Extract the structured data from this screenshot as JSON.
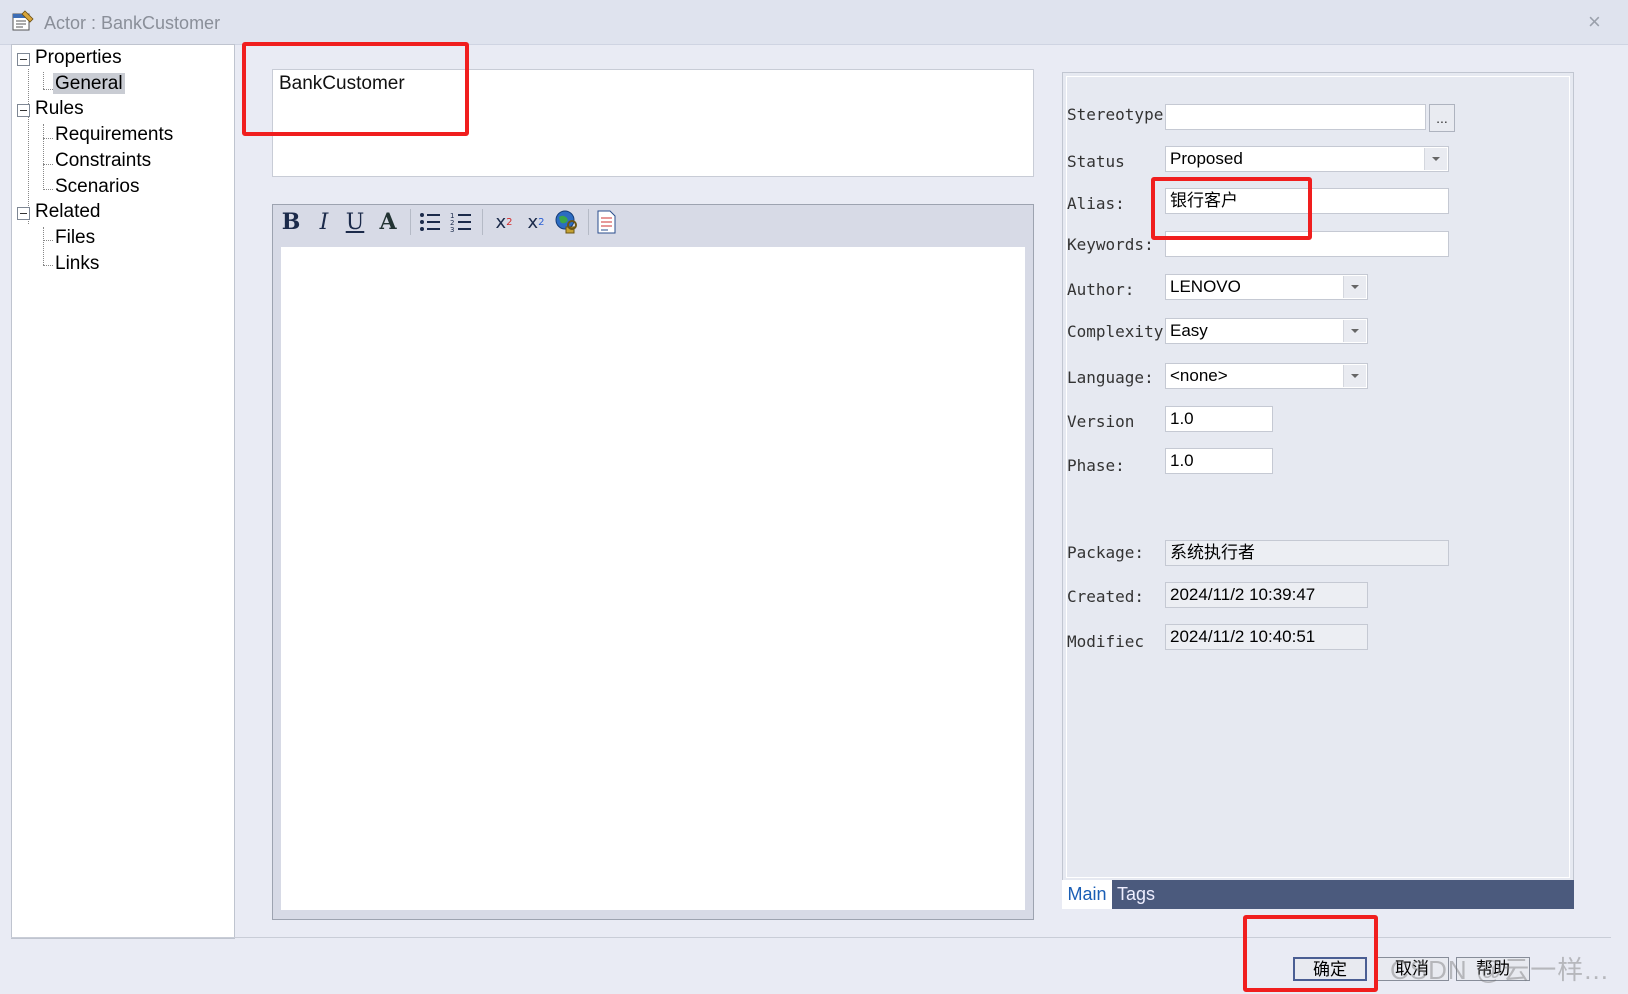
{
  "window": {
    "title": "Actor : BankCustomer",
    "close_label": "×"
  },
  "tree": {
    "properties": "Properties",
    "general": "General",
    "rules": "Rules",
    "requirements": "Requirements",
    "constraints": "Constraints",
    "scenarios": "Scenarios",
    "related": "Related",
    "files": "Files",
    "links": "Links"
  },
  "name_value": "BankCustomer",
  "toolbar": {
    "bold": "B",
    "italic": "I",
    "underline": "U",
    "font_color": "A",
    "superscript": "x",
    "subscript": "x"
  },
  "props": {
    "stereotype_label": "Stereotype",
    "stereotype_value": "",
    "browse_label": "...",
    "status_label": "Status",
    "status_value": "Proposed",
    "alias_label": "Alias:",
    "alias_value": "银行客户",
    "keywords_label": "Keywords:",
    "keywords_value": "",
    "author_label": "Author:",
    "author_value": "LENOVO",
    "complexity_label": "Complexity",
    "complexity_value": "Easy",
    "language_label": "Language:",
    "language_value": "<none>",
    "version_label": "Version",
    "version_value": "1.0",
    "phase_label": "Phase:",
    "phase_value": "1.0",
    "package_label": "Package:",
    "package_value": "系统执行者",
    "created_label": "Created:",
    "created_value": "2024/11/2 10:39:47",
    "modified_label": "Modifiec",
    "modified_value": "2024/11/2 10:40:51"
  },
  "tabs": {
    "main": "Main",
    "tags": "Tags"
  },
  "buttons": {
    "ok": "确定",
    "cancel": "取消",
    "help": "帮助"
  },
  "watermark": "CSDN @云一样..."
}
